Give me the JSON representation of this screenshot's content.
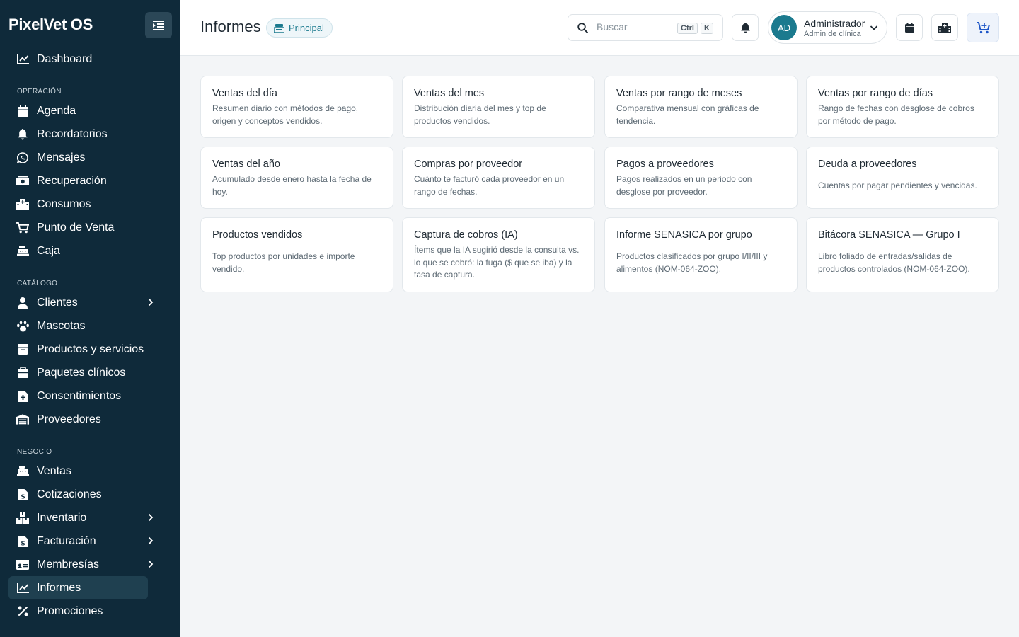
{
  "app": {
    "name": "PixelVet OS"
  },
  "sidebar": {
    "top_item": {
      "label": "Dashboard",
      "icon": "chart-line-icon"
    },
    "sections": [
      {
        "label": "OPERACIÓN",
        "items": [
          {
            "label": "Agenda",
            "icon": "calendar-icon"
          },
          {
            "label": "Recordatorios",
            "icon": "bell-icon"
          },
          {
            "label": "Mensajes",
            "icon": "whatsapp-icon"
          },
          {
            "label": "Recuperación",
            "icon": "money-bill-icon"
          },
          {
            "label": "Consumos",
            "icon": "hospital-icon"
          },
          {
            "label": "Punto de Venta",
            "icon": "cart-icon"
          },
          {
            "label": "Caja",
            "icon": "cash-register-icon"
          }
        ]
      },
      {
        "label": "CATÁLOGO",
        "items": [
          {
            "label": "Clientes",
            "icon": "user-icon",
            "expandable": true
          },
          {
            "label": "Mascotas",
            "icon": "paw-icon"
          },
          {
            "label": "Productos y servicios",
            "icon": "box-icon"
          },
          {
            "label": "Paquetes clínicos",
            "icon": "package-icon"
          },
          {
            "label": "Consentimientos",
            "icon": "file-medical-icon"
          },
          {
            "label": "Proveedores",
            "icon": "warehouse-icon"
          }
        ]
      },
      {
        "label": "NEGOCIO",
        "items": [
          {
            "label": "Ventas",
            "icon": "cash-register-icon"
          },
          {
            "label": "Cotizaciones",
            "icon": "file-invoice-dollar-icon"
          },
          {
            "label": "Inventario",
            "icon": "boxes-icon",
            "expandable": true
          },
          {
            "label": "Facturación",
            "icon": "file-invoice-icon",
            "expandable": true
          },
          {
            "label": "Membresías",
            "icon": "id-card-icon",
            "expandable": true
          },
          {
            "label": "Informes",
            "icon": "chart-line-icon",
            "active": true
          },
          {
            "label": "Promociones",
            "icon": "percent-icon"
          }
        ]
      }
    ]
  },
  "header": {
    "title": "Informes",
    "badge": "Principal",
    "search": {
      "placeholder": "Buscar",
      "kbd1": "Ctrl",
      "kbd2": "K"
    },
    "user": {
      "initials": "AD",
      "name": "Administrador",
      "role": "Admin de clínica"
    }
  },
  "reports": [
    {
      "title": "Ventas del día",
      "desc": "Resumen diario con métodos de pago, origen y conceptos vendidos."
    },
    {
      "title": "Ventas del mes",
      "desc": "Distribución diaria del mes y top de productos vendidos."
    },
    {
      "title": "Ventas por rango de meses",
      "desc": "Comparativa mensual con gráficas de tendencia."
    },
    {
      "title": "Ventas por rango de días",
      "desc": "Rango de fechas con desglose de cobros por método de pago."
    },
    {
      "title": "Ventas del año",
      "desc": "Acumulado desde enero hasta la fecha de hoy."
    },
    {
      "title": "Compras por proveedor",
      "desc": "Cuánto te facturó cada proveedor en un rango de fechas."
    },
    {
      "title": "Pagos a proveedores",
      "desc": "Pagos realizados en un periodo con desglose por proveedor."
    },
    {
      "title": "Deuda a proveedores",
      "desc": "Cuentas por pagar pendientes y vencidas."
    },
    {
      "title": "Productos vendidos",
      "desc": "Top productos por unidades e importe vendido."
    },
    {
      "title": "Captura de cobros (IA)",
      "desc": "Ítems que la IA sugirió desde la consulta vs. lo que se cobró: la fuga ($ que se iba) y la tasa de captura."
    },
    {
      "title": "Informe SENASICA por grupo",
      "desc": "Productos clasificados por grupo I/II/III y alimentos (NOM-064-ZOO)."
    },
    {
      "title": "Bitácora SENASICA — Grupo I",
      "desc": "Libro foliado de entradas/salidas de productos controlados (NOM-064-ZOO)."
    }
  ]
}
